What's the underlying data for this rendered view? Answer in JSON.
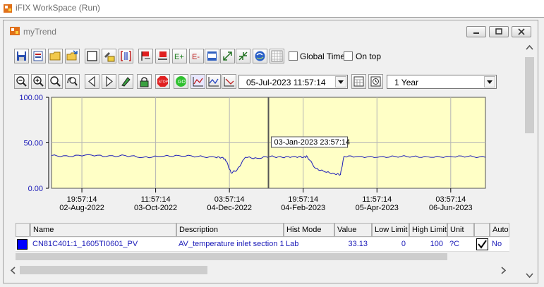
{
  "app": {
    "title": "iFIX WorkSpace (Run)"
  },
  "window": {
    "title": "myTrend"
  },
  "toolbar": {
    "global_time_label": "Global Time",
    "on_top_label": "On top",
    "start_time": "05-Jul-2023 11:57:14",
    "duration": "1 Year"
  },
  "chart_data": {
    "type": "line",
    "title": "",
    "xlabel": "",
    "ylabel": "",
    "ylim": [
      0,
      100
    ],
    "y_ticks": [
      "100.00",
      "50.00",
      "0.00"
    ],
    "x_ticks": [
      {
        "time": "19:57:14",
        "date": "02-Aug-2022"
      },
      {
        "time": "11:57:14",
        "date": "03-Oct-2022"
      },
      {
        "time": "03:57:14",
        "date": "04-Dec-2022"
      },
      {
        "time": "19:57:14",
        "date": "04-Feb-2023"
      },
      {
        "time": "11:57:14",
        "date": "05-Apr-2023"
      },
      {
        "time": "03:57:14",
        "date": "06-Jun-2023"
      }
    ],
    "grid": true,
    "cursor_label": "03-Jan-2023 23:57:14",
    "series": [
      {
        "name": "CN81C401:1_1605TI0601_PV",
        "color": "#1a1ab8",
        "x": [
          "2022-07-05",
          "2022-07-20",
          "2022-08-05",
          "2022-08-20",
          "2022-09-05",
          "2022-09-20",
          "2022-10-05",
          "2022-10-20",
          "2022-11-05",
          "2022-11-20",
          "2022-11-26",
          "2022-11-29",
          "2022-12-03",
          "2022-12-08",
          "2022-12-15",
          "2022-12-25",
          "2023-01-05",
          "2023-01-15",
          "2023-01-25",
          "2023-02-02",
          "2023-02-05",
          "2023-02-12",
          "2023-02-20",
          "2023-02-28",
          "2023-03-05",
          "2023-03-08",
          "2023-03-20",
          "2023-04-05",
          "2023-04-20",
          "2023-05-05",
          "2023-05-20",
          "2023-06-05",
          "2023-06-20",
          "2023-07-05"
        ],
        "values": [
          36,
          35,
          37,
          35,
          36,
          34,
          35,
          36,
          35,
          34,
          34,
          30,
          17,
          20,
          34,
          33,
          35,
          34,
          35,
          34,
          35,
          22,
          18,
          16,
          15,
          35,
          35,
          34,
          35,
          35,
          34,
          35,
          35,
          34
        ]
      }
    ]
  },
  "table": {
    "headers": [
      "Name",
      "Description",
      "Hist Mode",
      "Value",
      "Low Limit",
      "High Limit",
      "Unit",
      "Auto"
    ],
    "rows": [
      {
        "color": "#0000ff",
        "name": "CN81C401:1_1605TI0601_PV",
        "description": "AV_temperature inlet section 1",
        "hist_mode": "Lab",
        "value": "33.13",
        "low_limit": "0",
        "high_limit": "100",
        "unit": "?C",
        "checked": true,
        "auto": "No"
      }
    ]
  }
}
